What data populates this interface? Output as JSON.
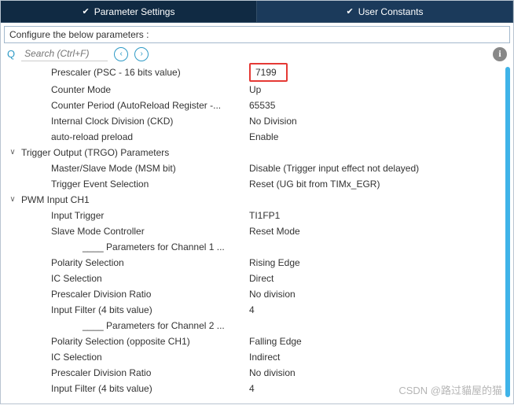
{
  "tabs": {
    "t1": "Parameter Settings",
    "t2": "User Constants"
  },
  "configure": "Configure the below parameters :",
  "search": {
    "placeholder": "Search (Ctrl+F)"
  },
  "rows": {
    "prescaler_label": "Prescaler (PSC - 16 bits value)",
    "prescaler_value": "7199",
    "counter_mode_label": "Counter Mode",
    "counter_mode_value": "Up",
    "counter_period_label": "Counter Period (AutoReload Register -...",
    "counter_period_value": "65535",
    "ckd_label": "Internal Clock Division (CKD)",
    "ckd_value": "No Division",
    "autoreload_label": "auto-reload preload",
    "autoreload_value": "Enable",
    "trgo_label": "Trigger Output (TRGO) Parameters",
    "msm_label": "Master/Slave Mode (MSM bit)",
    "msm_value": "Disable (Trigger input effect not delayed)",
    "tes_label": "Trigger Event Selection",
    "tes_value": "Reset (UG bit from TIMx_EGR)",
    "pwm_label": "PWM Input CH1",
    "input_trigger_label": "Input Trigger",
    "input_trigger_value": "TI1FP1",
    "slave_mode_label": "Slave Mode Controller",
    "slave_mode_value": "Reset Mode",
    "ch1_params": "____ Parameters for Channel 1 ...",
    "pol_sel_label": "Polarity Selection",
    "pol_sel_value": "Rising Edge",
    "ic_sel_label": "IC Selection",
    "ic_sel_value": "Direct",
    "psc_div_label": "Prescaler Division Ratio",
    "psc_div_value": "No division",
    "in_filter_label": "Input Filter (4 bits value)",
    "in_filter_value": "4",
    "ch2_params": "____ Parameters for Channel 2 ...",
    "pol_sel2_label": "Polarity Selection (opposite CH1)",
    "pol_sel2_value": "Falling Edge",
    "ic_sel2_label": "IC Selection",
    "ic_sel2_value": "Indirect",
    "psc_div2_label": "Prescaler Division Ratio",
    "psc_div2_value": "No division",
    "in_filter2_label": "Input Filter (4 bits value)",
    "in_filter2_value": "4"
  },
  "watermark": "CSDN @路过貓屋的猫"
}
